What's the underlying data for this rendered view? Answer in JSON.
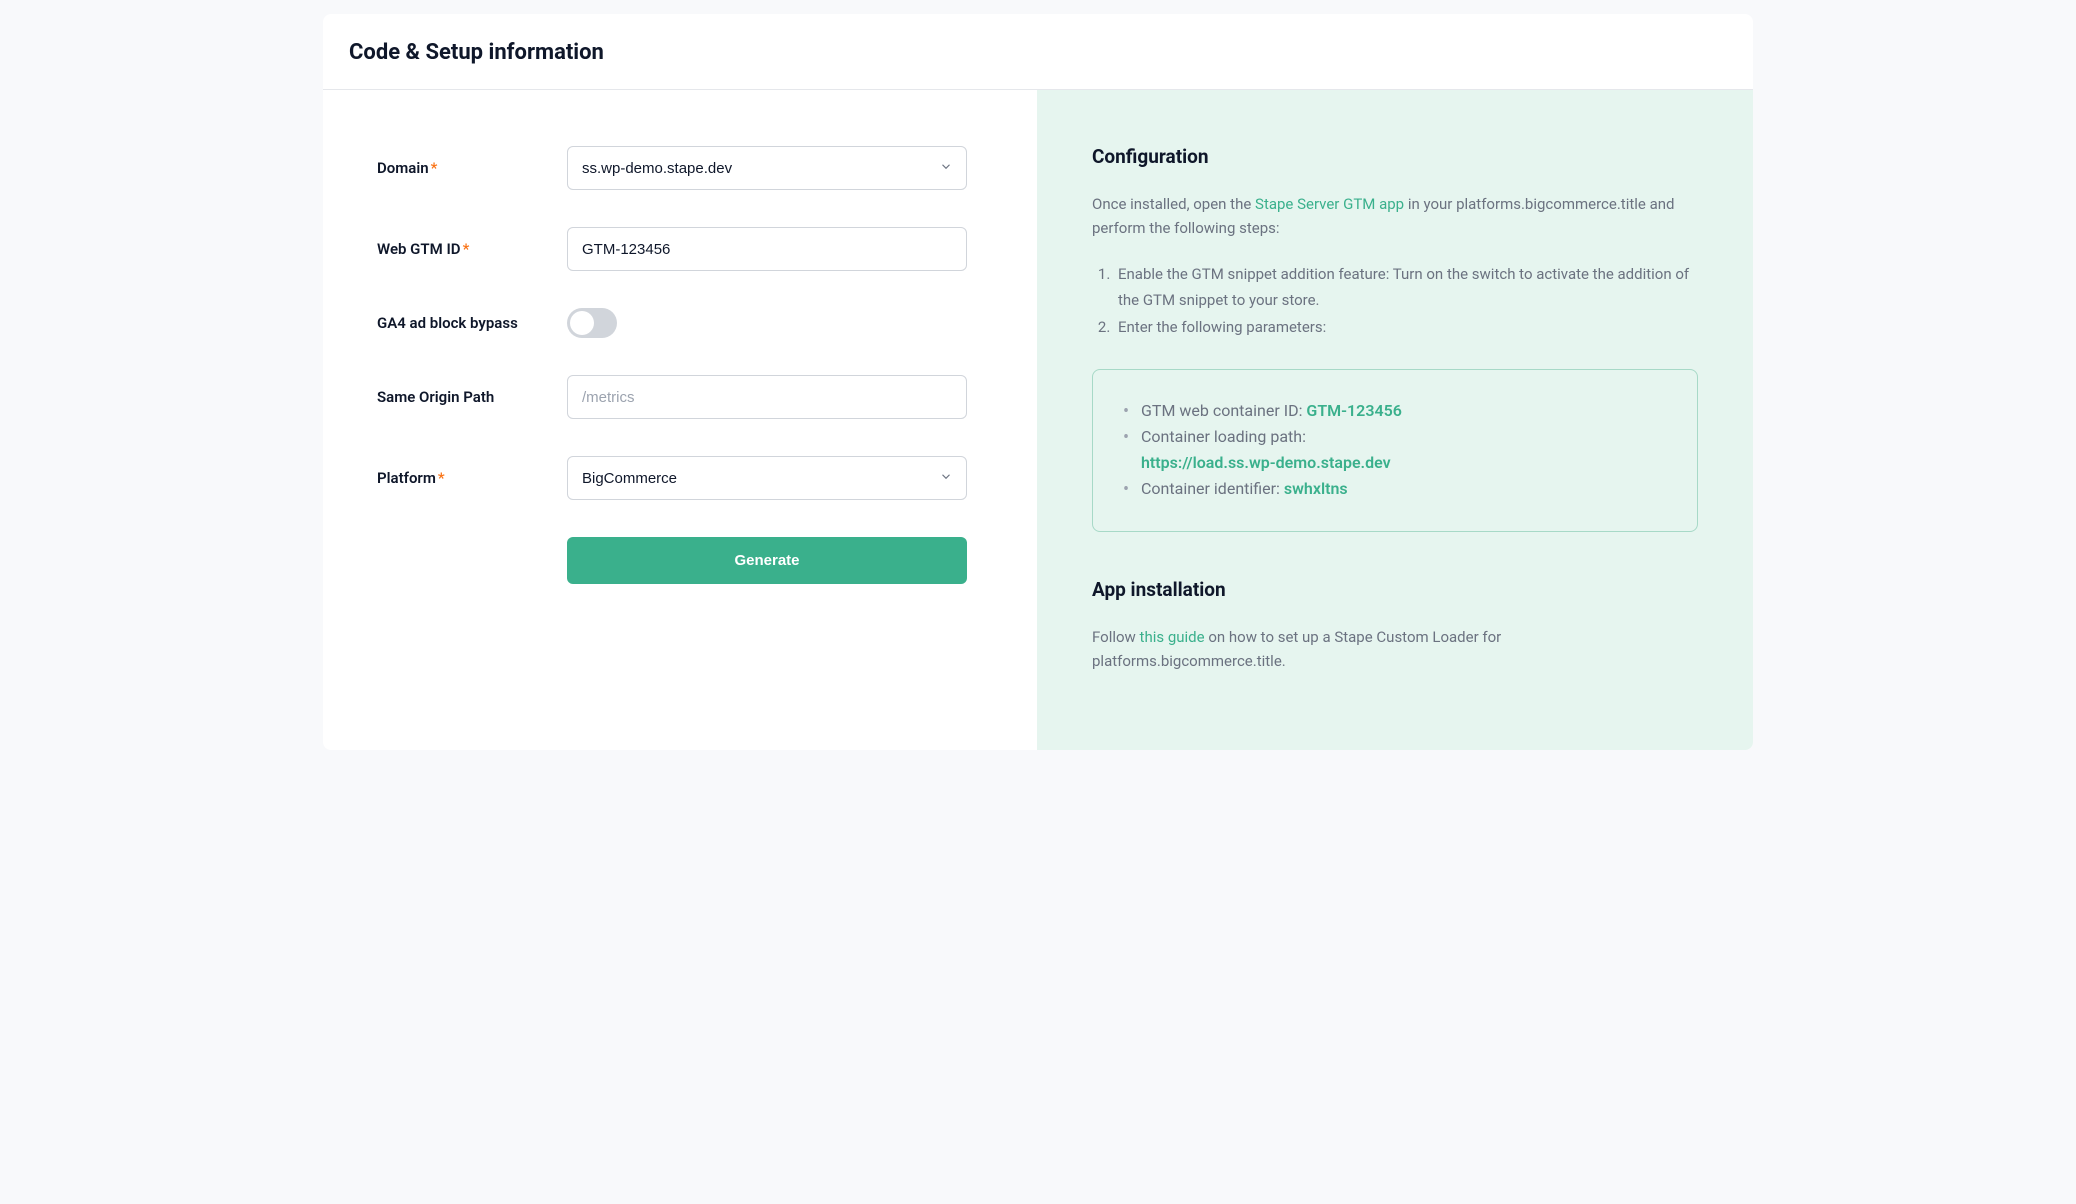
{
  "header": {
    "title": "Code & Setup information"
  },
  "form": {
    "domain": {
      "label": "Domain",
      "required": "*",
      "value": "ss.wp-demo.stape.dev"
    },
    "web_gtm_id": {
      "label": "Web GTM ID",
      "required": "*",
      "value": "GTM-123456"
    },
    "ga4_bypass": {
      "label": "GA4 ad block bypass"
    },
    "same_origin_path": {
      "label": "Same Origin Path",
      "placeholder": "/metrics"
    },
    "platform": {
      "label": "Platform",
      "required": "*",
      "value": "BigCommerce"
    },
    "generate_button": "Generate"
  },
  "config": {
    "title": "Configuration",
    "intro_prefix": "Once installed, open the ",
    "intro_link": "Stape Server GTM app",
    "intro_suffix": " in your platforms.bigcommerce.title and perform the following steps:",
    "steps": [
      "Enable the GTM snippet addition feature: Turn on the switch to activate the addition of the GTM snippet to your store.",
      "Enter the following parameters:"
    ],
    "params": {
      "gtm_id_label": "GTM web container ID: ",
      "gtm_id_value": "GTM-123456",
      "loading_path_label": "Container loading path:",
      "loading_path_value": "https://load.ss.wp-demo.stape.dev",
      "identifier_label": "Container identifier: ",
      "identifier_value": "swhxltns"
    }
  },
  "install": {
    "title": "App installation",
    "text_prefix": "Follow ",
    "text_link": "this guide",
    "text_suffix": " on how to set up a Stape Custom Loader for platforms.bigcommerce.title."
  }
}
